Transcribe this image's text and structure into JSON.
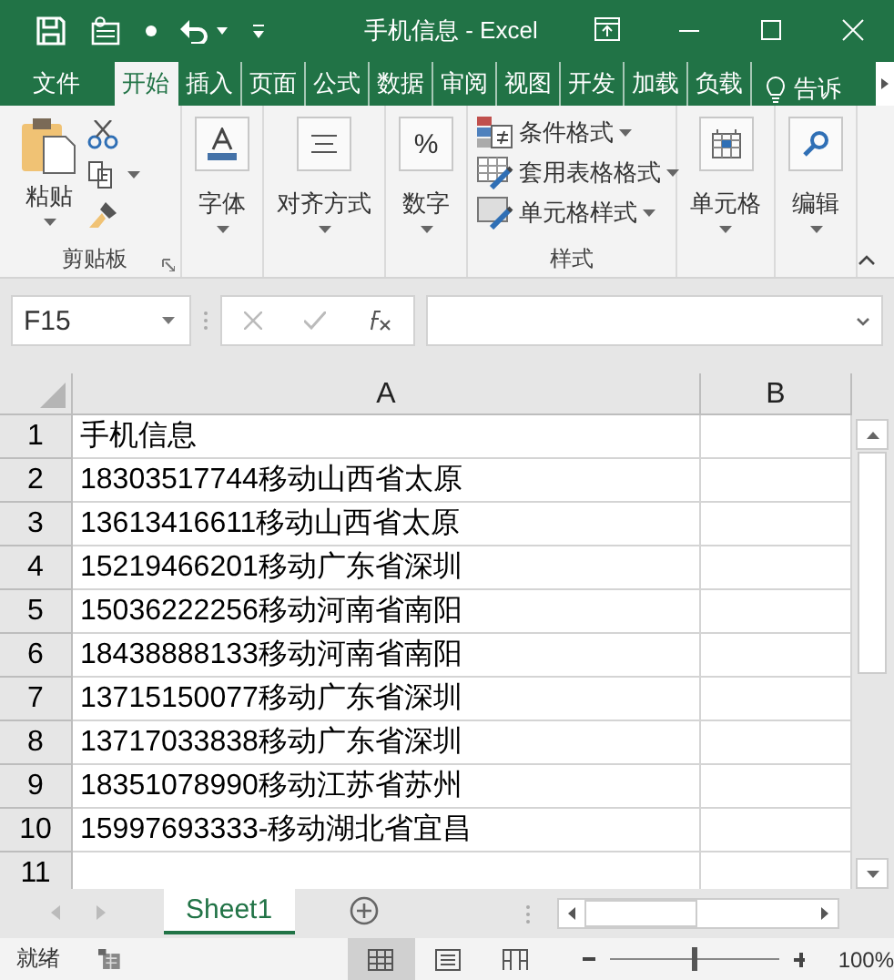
{
  "window": {
    "title": "手机信息 - Excel"
  },
  "tabs": [
    {
      "label": "文件",
      "selected": false
    },
    {
      "label": "开始",
      "selected": true
    },
    {
      "label": "插入",
      "selected": false
    },
    {
      "label": "页面",
      "selected": false
    },
    {
      "label": "公式",
      "selected": false
    },
    {
      "label": "数据",
      "selected": false
    },
    {
      "label": "审阅",
      "selected": false
    },
    {
      "label": "视图",
      "selected": false
    },
    {
      "label": "开发",
      "selected": false
    },
    {
      "label": "加载",
      "selected": false
    },
    {
      "label": "负载",
      "selected": false
    }
  ],
  "tell_me": {
    "label": "告诉"
  },
  "ribbon": {
    "clipboard": {
      "paste": "粘贴",
      "label": "剪贴板"
    },
    "buttons": [
      {
        "kind": "font",
        "label": "字体"
      },
      {
        "kind": "align",
        "label": "对齐方式"
      },
      {
        "kind": "number",
        "label": "数字",
        "icon": "%"
      }
    ],
    "styles": {
      "items": [
        {
          "kind": "conditional",
          "label": "条件格式"
        },
        {
          "kind": "table",
          "label": "套用表格格式"
        },
        {
          "kind": "cell",
          "label": "单元格样式"
        }
      ],
      "label": "样式"
    },
    "tail_buttons": [
      {
        "kind": "cells",
        "label": "单元格"
      },
      {
        "kind": "edit",
        "label": "编辑"
      }
    ]
  },
  "formula_bar": {
    "name_box": "F15"
  },
  "sheet": {
    "columns": [
      "A",
      "B"
    ],
    "rows": [
      {
        "number": "1",
        "a": "手机信息"
      },
      {
        "number": "2",
        "a": "18303517744移动山西省太原"
      },
      {
        "number": "3",
        "a": "13613416611移动山西省太原"
      },
      {
        "number": "4",
        "a": "15219466201移动广东省深圳"
      },
      {
        "number": "5",
        "a": "15036222256移动河南省南阳"
      },
      {
        "number": "6",
        "a": "18438888133移动河南省南阳"
      },
      {
        "number": "7",
        "a": "13715150077移动广东省深圳"
      },
      {
        "number": "8",
        "a": "13717033838移动广东省深圳"
      },
      {
        "number": "9",
        "a": "18351078990移动江苏省苏州"
      },
      {
        "number": "10",
        "a": "15997693333-移动湖北省宜昌"
      },
      {
        "number": "11"
      }
    ]
  },
  "sheet_tabs": [
    {
      "label": "Sheet1",
      "selected": true
    }
  ],
  "status_bar": {
    "status": "就绪",
    "views": [
      {
        "kind": "normal",
        "selected": true
      },
      {
        "kind": "layout",
        "selected": false
      },
      {
        "kind": "pagebreak",
        "selected": false
      }
    ],
    "zoom": {
      "level": 0.5,
      "reading": "100%"
    }
  }
}
